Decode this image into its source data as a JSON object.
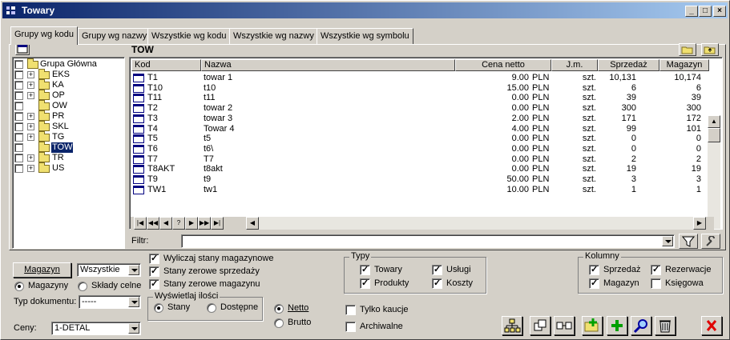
{
  "window": {
    "title": "Towary"
  },
  "tabs": [
    {
      "label": "Grupy wg kodu"
    },
    {
      "label": "Grupy wg nazwy"
    },
    {
      "label": "Wszystkie wg kodu"
    },
    {
      "label": "Wszystkie wg nazwy"
    },
    {
      "label": "Wszystkie wg symbolu"
    }
  ],
  "current_group": "TOW",
  "tree": {
    "root": "Grupa Główna",
    "items": [
      {
        "label": "EKS",
        "expandable": true
      },
      {
        "label": "KA",
        "expandable": true
      },
      {
        "label": "OP",
        "expandable": true
      },
      {
        "label": "OW",
        "expandable": false
      },
      {
        "label": "PR",
        "expandable": true
      },
      {
        "label": "SKL",
        "expandable": true
      },
      {
        "label": "TG",
        "expandable": true
      },
      {
        "label": "TOW",
        "expandable": false,
        "selected": true
      },
      {
        "label": "TR",
        "expandable": true
      },
      {
        "label": "US",
        "expandable": true
      }
    ]
  },
  "grid": {
    "columns": [
      "Kod",
      "Nazwa",
      "Cena netto",
      "J.m.",
      "Sprzedaż",
      "Magazyn"
    ],
    "rows": [
      {
        "kod": "T1",
        "nazwa": "towar 1",
        "cena": "9.00",
        "waluta": "PLN",
        "jm": "szt.",
        "sprzedaz": "10,131",
        "magazyn": "10,174"
      },
      {
        "kod": "T10",
        "nazwa": "t10",
        "cena": "15.00",
        "waluta": "PLN",
        "jm": "szt.",
        "sprzedaz": "6",
        "magazyn": "6"
      },
      {
        "kod": "T11",
        "nazwa": "t11",
        "cena": "0.00",
        "waluta": "PLN",
        "jm": "szt.",
        "sprzedaz": "39",
        "magazyn": "39"
      },
      {
        "kod": "T2",
        "nazwa": "towar 2",
        "cena": "0.00",
        "waluta": "PLN",
        "jm": "szt.",
        "sprzedaz": "300",
        "magazyn": "300"
      },
      {
        "kod": "T3",
        "nazwa": "towar 3",
        "cena": "2.00",
        "waluta": "PLN",
        "jm": "szt.",
        "sprzedaz": "171",
        "magazyn": "172"
      },
      {
        "kod": "T4",
        "nazwa": "Towar 4",
        "cena": "4.00",
        "waluta": "PLN",
        "jm": "szt.",
        "sprzedaz": "99",
        "magazyn": "101"
      },
      {
        "kod": "T5",
        "nazwa": "t5",
        "cena": "0.00",
        "waluta": "PLN",
        "jm": "szt.",
        "sprzedaz": "0",
        "magazyn": "0"
      },
      {
        "kod": "T6",
        "nazwa": "t6\\",
        "cena": "0.00",
        "waluta": "PLN",
        "jm": "szt.",
        "sprzedaz": "0",
        "magazyn": "0"
      },
      {
        "kod": "T7",
        "nazwa": "T7",
        "cena": "0.00",
        "waluta": "PLN",
        "jm": "szt.",
        "sprzedaz": "2",
        "magazyn": "2"
      },
      {
        "kod": "T8AKT",
        "nazwa": "t8akt",
        "cena": "0.00",
        "waluta": "PLN",
        "jm": "szt.",
        "sprzedaz": "19",
        "magazyn": "19"
      },
      {
        "kod": "T9",
        "nazwa": "t9",
        "cena": "50.00",
        "waluta": "PLN",
        "jm": "szt.",
        "sprzedaz": "3",
        "magazyn": "3"
      },
      {
        "kod": "TW1",
        "nazwa": "tw1",
        "cena": "10.00",
        "waluta": "PLN",
        "jm": "szt.",
        "sprzedaz": "1",
        "magazyn": "1"
      }
    ]
  },
  "filter": {
    "label": "Filtr:",
    "value": ""
  },
  "bottom": {
    "magazyn_button": "Magazyn",
    "magazyn_select": "Wszystkie",
    "radio_magazyny": "Magazyny",
    "radio_sklady": "Składy celne",
    "typ_dokumentu_label": "Typ dokumentu:",
    "typ_dokumentu_value": "-----",
    "ceny_label": "Ceny:",
    "ceny_value": "1-DETAL",
    "check_wyliczaj": "Wyliczaj stany magazynowe",
    "check_stany_sprzedazy": "Stany zerowe sprzedaży",
    "check_stany_magazynu": "Stany zerowe magazynu",
    "wyswietlaj_title": "Wyświetlaj ilości",
    "radio_stany": "Stany",
    "radio_dostepne": "Dostępne",
    "radio_netto": "Netto",
    "radio_brutto": "Brutto",
    "check_kaucje": "Tylko kaucje",
    "check_archiwalne": "Archiwalne",
    "typy_title": "Typy",
    "typy_towary": "Towary",
    "typy_uslugi": "Usługi",
    "typy_produkty": "Produkty",
    "typy_koszty": "Koszty",
    "kolumny_title": "Kolumny",
    "kol_sprzedaz": "Sprzedaż",
    "kol_rezerwacje": "Rezerwacje",
    "kol_magazyn": "Magazyn",
    "kol_ksiegowa": "Księgowa"
  },
  "colors": {
    "title_start": "#0a246a",
    "title_end": "#a6caf0",
    "selection": "#0a246a"
  }
}
